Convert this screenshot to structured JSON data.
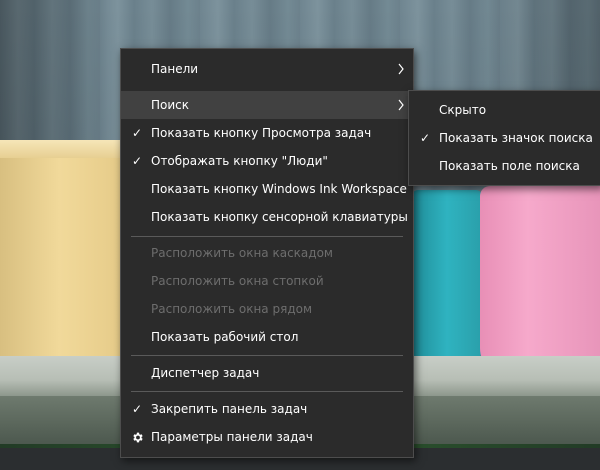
{
  "context_menu": {
    "items": [
      {
        "label": "Панели",
        "checked": false,
        "submenu": true,
        "disabled": false
      },
      {
        "label": "Поиск",
        "checked": false,
        "submenu": true,
        "disabled": false,
        "highlighted": true
      },
      {
        "label": "Показать кнопку Просмотра задач",
        "checked": true,
        "submenu": false,
        "disabled": false
      },
      {
        "label": "Отображать кнопку \"Люди\"",
        "checked": true,
        "submenu": false,
        "disabled": false
      },
      {
        "label": "Показать кнопку Windows Ink Workspace",
        "checked": false,
        "submenu": false,
        "disabled": false
      },
      {
        "label": "Показать кнопку сенсорной клавиатуры",
        "checked": false,
        "submenu": false,
        "disabled": false
      },
      {
        "label": "Расположить окна каскадом",
        "checked": false,
        "submenu": false,
        "disabled": true
      },
      {
        "label": "Расположить окна стопкой",
        "checked": false,
        "submenu": false,
        "disabled": true
      },
      {
        "label": "Расположить окна рядом",
        "checked": false,
        "submenu": false,
        "disabled": true
      },
      {
        "label": "Показать рабочий стол",
        "checked": false,
        "submenu": false,
        "disabled": false
      },
      {
        "label": "Диспетчер задач",
        "checked": false,
        "submenu": false,
        "disabled": false
      },
      {
        "label": "Закрепить панель задач",
        "checked": true,
        "submenu": false,
        "disabled": false
      },
      {
        "label": "Параметры панели задач",
        "checked": false,
        "submenu": false,
        "disabled": false,
        "icon": "gear-icon"
      }
    ]
  },
  "search_submenu": {
    "items": [
      {
        "label": "Скрыто",
        "checked": false
      },
      {
        "label": "Показать значок поиска",
        "checked": true
      },
      {
        "label": "Показать поле поиска",
        "checked": false
      }
    ]
  },
  "glyphs": {
    "check": "✓",
    "chevron": "›"
  },
  "colors": {
    "menu_bg": "#2b2b2b",
    "menu_hover": "#414141",
    "menu_text": "#ffffff",
    "menu_disabled_text": "#6d6d6d",
    "separator": "#5a5a5a"
  }
}
